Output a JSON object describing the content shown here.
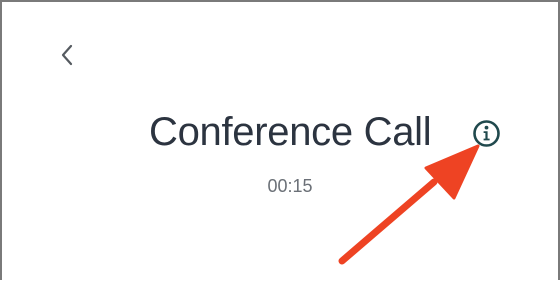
{
  "header": {
    "back_icon": "chevron-left-icon"
  },
  "call": {
    "title": "Conference Call",
    "duration": "00:15",
    "info_icon": "info-circle-icon"
  },
  "annotation": {
    "arrow_icon": "arrow-icon",
    "arrow_color": "#ee4323"
  },
  "colors": {
    "title_text": "#2c3440",
    "timer_text": "#6b7077",
    "icon": "#20494d",
    "frame_border": "#7a7a7a"
  }
}
